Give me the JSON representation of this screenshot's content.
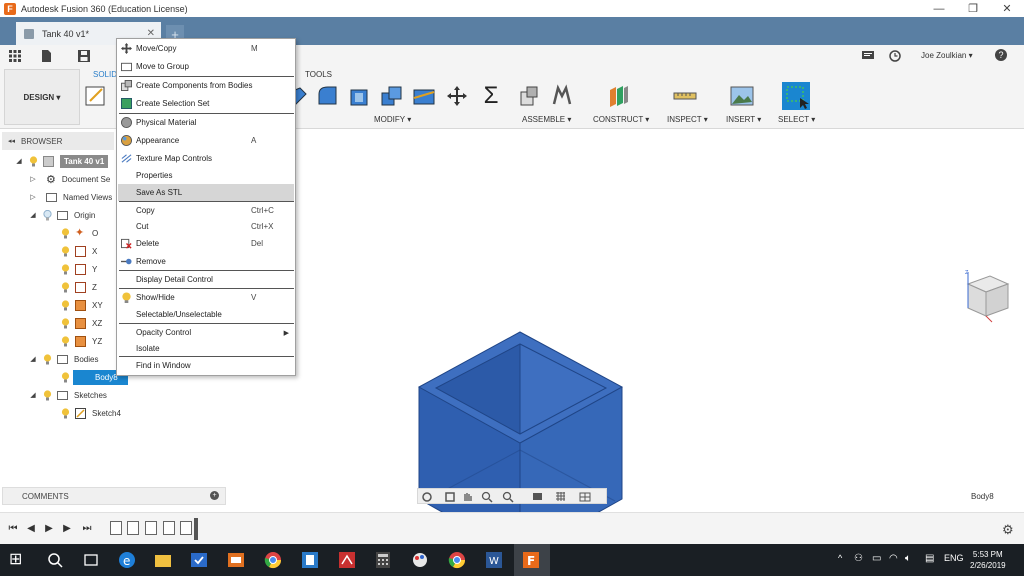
{
  "window": {
    "title": "Autodesk Fusion 360 (Education License)",
    "logo_letter": "F",
    "minimize": "—",
    "maximize": "❐",
    "close": "✕"
  },
  "document_tab": {
    "label": "Tank 40 v1*",
    "close": "✕",
    "new_tab": "+"
  },
  "qat": {
    "user": "Joe Zoulkian ▾",
    "help": "?"
  },
  "ribbon": {
    "workspace": "DESIGN ▾",
    "tabs": {
      "solid": "SOLID",
      "tools": "TOOLS"
    },
    "groups": {
      "modify": "MODIFY ▾",
      "assemble": "ASSEMBLE ▾",
      "construct": "CONSTRUCT ▾",
      "inspect": "INSPECT ▾",
      "insert": "INSERT ▾",
      "select": "SELECT ▾"
    },
    "sigma": "Σ"
  },
  "browser": {
    "header": "BROWSER",
    "collapse_icon": "◂◂",
    "root": "Tank 40 v1",
    "document_settings": "Document Se",
    "named_views": "Named Views",
    "origin": "Origin",
    "origin_items": [
      "O",
      "X",
      "Y",
      "Z",
      "XY",
      "XZ",
      "YZ"
    ],
    "bodies": "Bodies",
    "body8": "Body8",
    "sketches": "Sketches",
    "sketch4": "Sketch4"
  },
  "context_menu": {
    "items": [
      {
        "label": "Move/Copy",
        "shortcut": "M"
      },
      {
        "label": "Move to Group",
        "shortcut": ""
      },
      {
        "label": "Create Components from Bodies",
        "shortcut": ""
      },
      {
        "label": "Create Selection Set",
        "shortcut": ""
      },
      {
        "label": "Physical Material",
        "shortcut": ""
      },
      {
        "label": "Appearance",
        "shortcut": "A"
      },
      {
        "label": "Texture Map Controls",
        "shortcut": ""
      },
      {
        "label": "Properties",
        "shortcut": ""
      },
      {
        "label": "Save As STL",
        "shortcut": ""
      },
      {
        "label": "Copy",
        "shortcut": "Ctrl+C"
      },
      {
        "label": "Cut",
        "shortcut": "Ctrl+X"
      },
      {
        "label": "Delete",
        "shortcut": "Del"
      },
      {
        "label": "Remove",
        "shortcut": ""
      },
      {
        "label": "Display Detail Control",
        "shortcut": ""
      },
      {
        "label": "Show/Hide",
        "shortcut": "V"
      },
      {
        "label": "Selectable/Unselectable",
        "shortcut": ""
      },
      {
        "label": "Opacity Control",
        "shortcut": ""
      },
      {
        "label": "Isolate",
        "shortcut": ""
      },
      {
        "label": "Find in Window",
        "shortcut": ""
      }
    ],
    "submenu_arrow": "▶"
  },
  "comments": {
    "label": "COMMENTS",
    "add": "+"
  },
  "status": {
    "selection": "Body8"
  },
  "timeline": {
    "first": "⏮",
    "prev": "◀",
    "play": "▶",
    "next": "▶",
    "last": "⏭",
    "settings": "⚙"
  },
  "taskbar": {
    "start": "⊞",
    "lang": "ENG",
    "time": "5:53 PM",
    "date": "2/26/2019"
  },
  "colors": {
    "accent": "#2a7ec9",
    "body_blue": "#2f5fb0",
    "tab_bar": "#5a7fa3",
    "selection": "#1a86d0"
  }
}
